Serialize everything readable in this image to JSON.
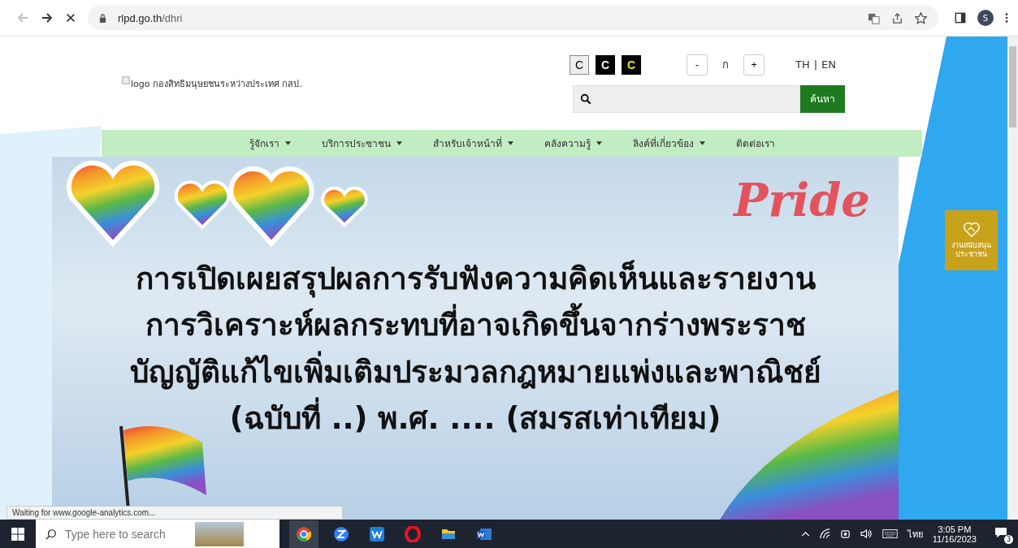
{
  "browser": {
    "url_host": "rlpd.go.th",
    "url_path": "/dhri",
    "back_disabled": true,
    "profile_initial": "S"
  },
  "header": {
    "logo_alt": "logo กองสิทธิมนุษยชนระหว่างประเทศ กสป.",
    "contrast_buttons": [
      {
        "label": "C",
        "kind": "normal"
      },
      {
        "label": "C",
        "kind": "dark"
      },
      {
        "label": "C",
        "kind": "yellow"
      }
    ],
    "font_buttons": [
      {
        "label": "-",
        "kind": "button"
      },
      {
        "label": "ก",
        "kind": "plain"
      },
      {
        "label": "+",
        "kind": "button"
      }
    ],
    "languages": [
      "TH",
      "EN"
    ],
    "language_separator": "|",
    "search": {
      "button": "ค้นหา"
    }
  },
  "nav": [
    {
      "label": "รู้จักเรา",
      "dropdown": true
    },
    {
      "label": "บริการประชาชน",
      "dropdown": true
    },
    {
      "label": "สำหรับเจ้าหน้าที่",
      "dropdown": true
    },
    {
      "label": "คลังความรู้",
      "dropdown": true
    },
    {
      "label": "ลิงค์ที่เกี่ยวข้อง",
      "dropdown": true
    },
    {
      "label": "ติดต่อเรา",
      "dropdown": false
    }
  ],
  "banner": {
    "badge": "Pride",
    "title": "การเปิดเผยสรุปผลการรับฟังความคิดเห็นและรายงาน\nการวิเคราะห์ผลกระทบที่อาจเกิดขึ้นจากร่างพระราช\nบัญญัติแก้ไขเพิ่มเติมประมวลกฎหมายแพ่งและพาณิชย์\n(ฉบับที่ ..) พ.ศ. .... (สมรสเท่าเทียม)"
  },
  "side_button": "งานสนับสนุน\nประชาชน",
  "status_text": "Waiting for www.google-analytics.com...",
  "taskbar": {
    "search_placeholder": "Type here to search",
    "language": "ไทย",
    "time": "3:05 PM",
    "date": "11/16/2023",
    "notifications": "3"
  }
}
